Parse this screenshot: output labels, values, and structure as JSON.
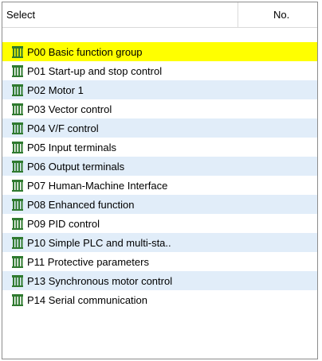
{
  "table": {
    "columns": {
      "select": "Select",
      "no": "No."
    },
    "items": [
      {
        "label": "P00 Basic function group",
        "no": ""
      },
      {
        "label": "P01 Start-up and stop control",
        "no": ""
      },
      {
        "label": "P02 Motor 1",
        "no": ""
      },
      {
        "label": "P03 Vector control",
        "no": ""
      },
      {
        "label": "P04 V/F control",
        "no": ""
      },
      {
        "label": "P05 Input terminals",
        "no": ""
      },
      {
        "label": "P06 Output terminals",
        "no": ""
      },
      {
        "label": "P07 Human-Machine Interface",
        "no": ""
      },
      {
        "label": "P08 Enhanced function",
        "no": ""
      },
      {
        "label": "P09 PID control",
        "no": ""
      },
      {
        "label": "P10 Simple PLC and multi-sta..",
        "no": ""
      },
      {
        "label": "P11 Protective parameters",
        "no": ""
      },
      {
        "label": "P13 Synchronous motor control",
        "no": ""
      },
      {
        "label": "P14 Serial communication",
        "no": ""
      }
    ],
    "selected_index": 0,
    "icon": "parameter-group-icon",
    "colors": {
      "selected_row": "#ffff00",
      "alt_row": "#e1edf9",
      "icon_green": "#2f7a2f"
    }
  }
}
